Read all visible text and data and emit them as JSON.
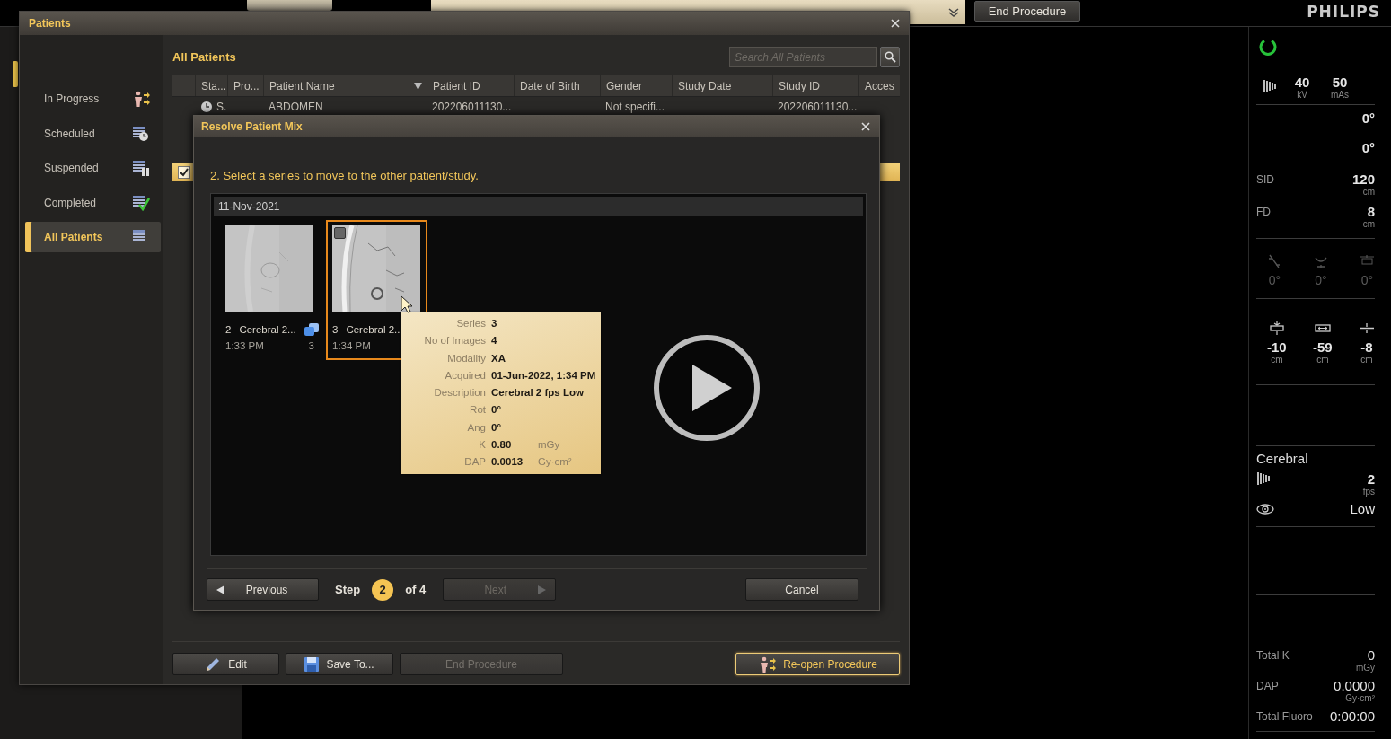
{
  "top_bar": {
    "end_procedure_button": "End Procedure",
    "logo": "PHILIPS"
  },
  "patients_window": {
    "title": "Patients",
    "sidebar": {
      "items": [
        {
          "label": "In Progress",
          "kind": "in_progress",
          "selected": false
        },
        {
          "label": "Scheduled",
          "kind": "scheduled",
          "selected": false
        },
        {
          "label": "Suspended",
          "kind": "suspended",
          "selected": false
        },
        {
          "label": "Completed",
          "kind": "completed",
          "selected": false
        },
        {
          "label": "All Patients",
          "kind": "all",
          "selected": true
        }
      ]
    },
    "heading": "All Patients",
    "search": {
      "placeholder": "Search All Patients"
    },
    "table": {
      "columns": [
        {
          "label": "Sta...",
          "sorted": false
        },
        {
          "label": "Pro...",
          "sorted": false
        },
        {
          "label": "Patient Name",
          "sorted": true
        },
        {
          "label": "Patient ID",
          "sorted": false
        },
        {
          "label": "Date of Birth",
          "sorted": false
        },
        {
          "label": "Gender",
          "sorted": false
        },
        {
          "label": "Study Date",
          "sorted": false
        },
        {
          "label": "Study ID",
          "sorted": false
        },
        {
          "label": "Acces",
          "sorted": false
        }
      ],
      "rows": [
        {
          "cells": [
            "S.",
            "",
            "ABDOMEN",
            "202206011130...",
            "",
            "Not specifi...",
            "",
            "202206011130...",
            ""
          ],
          "checked": false,
          "selected": false
        },
        {
          "checked": true,
          "selected": true
        }
      ]
    },
    "buttons": [
      {
        "label": "Edit",
        "kind": "pencil",
        "disabled": false,
        "highlighted": false
      },
      {
        "label": "Save To...",
        "kind": "disk",
        "disabled": false,
        "highlighted": false
      },
      {
        "label": "End Procedure",
        "kind": "plain",
        "disabled": true,
        "highlighted": false
      },
      {
        "label": "Re-open Procedure",
        "kind": "person",
        "disabled": false,
        "highlighted": true
      }
    ]
  },
  "dialog": {
    "title": "Resolve Patient Mix",
    "instruction": "2. Select a series to move to the other patient/study.",
    "group_date": "11-Nov-2021",
    "series": [
      {
        "number": "2",
        "name": "Cerebral 2...",
        "time": "1:33 PM",
        "count": "3",
        "selected": false
      },
      {
        "number": "3",
        "name": "Cerebral 2...",
        "time": "1:34 PM",
        "selected": true
      }
    ],
    "tooltip": {
      "rows": [
        {
          "label": "Series",
          "value": "3"
        },
        {
          "label": "No of Images",
          "value": "4"
        },
        {
          "label": "Modality",
          "value": "XA"
        },
        {
          "label": "Acquired",
          "value": "01-Jun-2022, 1:34 PM"
        },
        {
          "label": "Description",
          "value": "Cerebral 2 fps Low"
        },
        {
          "label": "Rot",
          "value": "0°"
        },
        {
          "label": "Ang",
          "value": "0°"
        },
        {
          "label": "K",
          "value": "0.80",
          "unit": "mGy"
        },
        {
          "label": "DAP",
          "value": "0.0013",
          "unit": "Gy·cm²"
        }
      ]
    },
    "footer": {
      "previous": "Previous",
      "step_label": "Step",
      "step_number": "2",
      "step_total": "of 4",
      "next": {
        "label": "Next",
        "disabled": true
      },
      "cancel": "Cancel"
    }
  },
  "status_panel": {
    "exposure": [
      {
        "value": "40",
        "unit": "kV"
      },
      {
        "value": "50",
        "unit": "mAs"
      }
    ],
    "angles": [
      "0°",
      "0°"
    ],
    "distances": [
      {
        "label": "SID",
        "value": "120",
        "unit": "cm"
      },
      {
        "label": "FD",
        "value": "8",
        "unit": "cm"
      }
    ],
    "rotations": [
      {
        "kind": "tilt",
        "value": "0°",
        "disabled": true
      },
      {
        "kind": "cradle",
        "value": "0°",
        "disabled": true
      },
      {
        "kind": "swivel",
        "value": "0°",
        "disabled": true
      }
    ],
    "table_positions": [
      {
        "kind": "height",
        "value": "-10",
        "unit": "cm"
      },
      {
        "kind": "longitudinal",
        "value": "-59",
        "unit": "cm"
      },
      {
        "kind": "lateral",
        "value": "-8",
        "unit": "cm"
      }
    ],
    "protocol": {
      "name": "Cerebral",
      "frame_rate": "2",
      "frame_unit": "fps",
      "dose_level": "Low"
    },
    "totals": [
      {
        "label": "Total K",
        "value": "0",
        "unit": "mGy"
      },
      {
        "label": "DAP",
        "value": "0.0000",
        "unit": "Gy·cm²"
      },
      {
        "label": "Total Fluoro",
        "value": "0:00:00"
      }
    ]
  }
}
